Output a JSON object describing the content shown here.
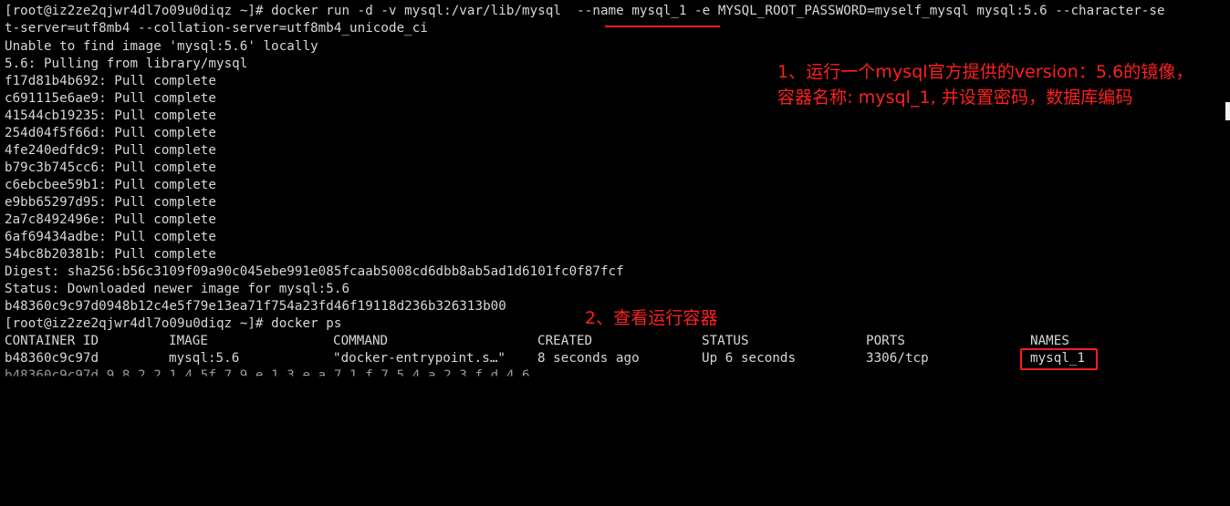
{
  "terminal": {
    "lines": [
      "[root@iz2ze2qjwr4dl7o09u0diqz ~]# docker run -d -v mysql:/var/lib/mysql  --name mysql_1 -e MYSQL_ROOT_PASSWORD=myself_mysql mysql:5.6 --character-se",
      "t-server=utf8mb4 --collation-server=utf8mb4_unicode_ci",
      "Unable to find image 'mysql:5.6' locally",
      "5.6: Pulling from library/mysql",
      "f17d81b4b692: Pull complete",
      "c691115e6ae9: Pull complete",
      "41544cb19235: Pull complete",
      "254d04f5f66d: Pull complete",
      "4fe240edfdc9: Pull complete",
      "b79c3b745cc6: Pull complete",
      "c6ebcbee59b1: Pull complete",
      "e9bb65297d95: Pull complete",
      "2a7c8492496e: Pull complete",
      "6af69434adbe: Pull complete",
      "54bc8b20381b: Pull complete",
      "Digest: sha256:b56c3109f09a90c045ebe991e085fcaab5008cd6dbb8ab5ad1d6101fc0f87fcf",
      "Status: Downloaded newer image for mysql:5.6",
      "b48360c9c97d0948b12c4e5f79e13ea71f754a23fd46f19118d236b326313b00",
      "[root@iz2ze2qjwr4dl7o09u0diqz ~]# docker ps"
    ],
    "ps_headers": [
      "CONTAINER ID",
      "IMAGE",
      "COMMAND",
      "CREATED",
      "STATUS",
      "PORTS",
      "NAMES"
    ],
    "ps_row": [
      "b48360c9c97d",
      "mysql:5.6",
      "\"docker-entrypoint.s…\"",
      "8 seconds ago",
      "Up 6 seconds",
      "3306/tcp",
      "mysql_1"
    ],
    "cut_line": "b48360c9c97d 9 8 2 2 1 4 5f 7 9 e 1 3 e a 7 1 f 7 5 4 a 2 3 f d 4 6"
  },
  "annotations": {
    "note1_line1": "1、运行一个mysql官方提供的version：5.6的镜像，",
    "note1_line2": "容器名称: mysql_1, 并设置密码，数据库编码",
    "note2": "2、查看运行容器"
  },
  "colors": {
    "background": "#000000",
    "text": "#d7d7d7",
    "annotation": "#ff2020"
  }
}
